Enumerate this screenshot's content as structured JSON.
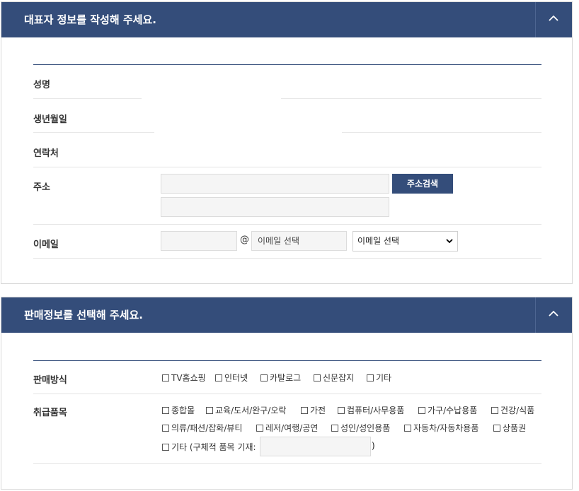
{
  "rep": {
    "title": "대표자 정보를 작성해 주세요.",
    "collapse_icon": "chevron-up-icon",
    "fields": {
      "name_label": "성명",
      "birth_label": "생년월일",
      "contact_label": "연락처",
      "address_label": "주소",
      "address_search_button": "주소검색",
      "email_label": "이메일",
      "email_at": "@",
      "email_domain_placeholder": "이메일 선택",
      "email_select_value": "이메일 선택"
    }
  },
  "sales": {
    "title": "판매정보를 선택해 주세요.",
    "collapse_icon": "chevron-up-icon",
    "method_label": "판매방식",
    "methods": [
      "TV홈쇼핑",
      "인터넷",
      "카탈로그",
      "신문잡지",
      "기타"
    ],
    "items_label": "취급품목",
    "items_row1": [
      "종합몰",
      "교육/도서/완구/오락",
      "가전",
      "컴퓨터/사무용품",
      "가구/수납용품",
      "건강/식품"
    ],
    "items_row2": [
      "의류/패션/잡화/뷰티",
      "레저/여행/공연",
      "성인/성인용품",
      "자동차/자동차용품",
      "상품권"
    ],
    "items_other": "기타 (구체적 품목 기재:",
    "items_other_close": ")"
  }
}
